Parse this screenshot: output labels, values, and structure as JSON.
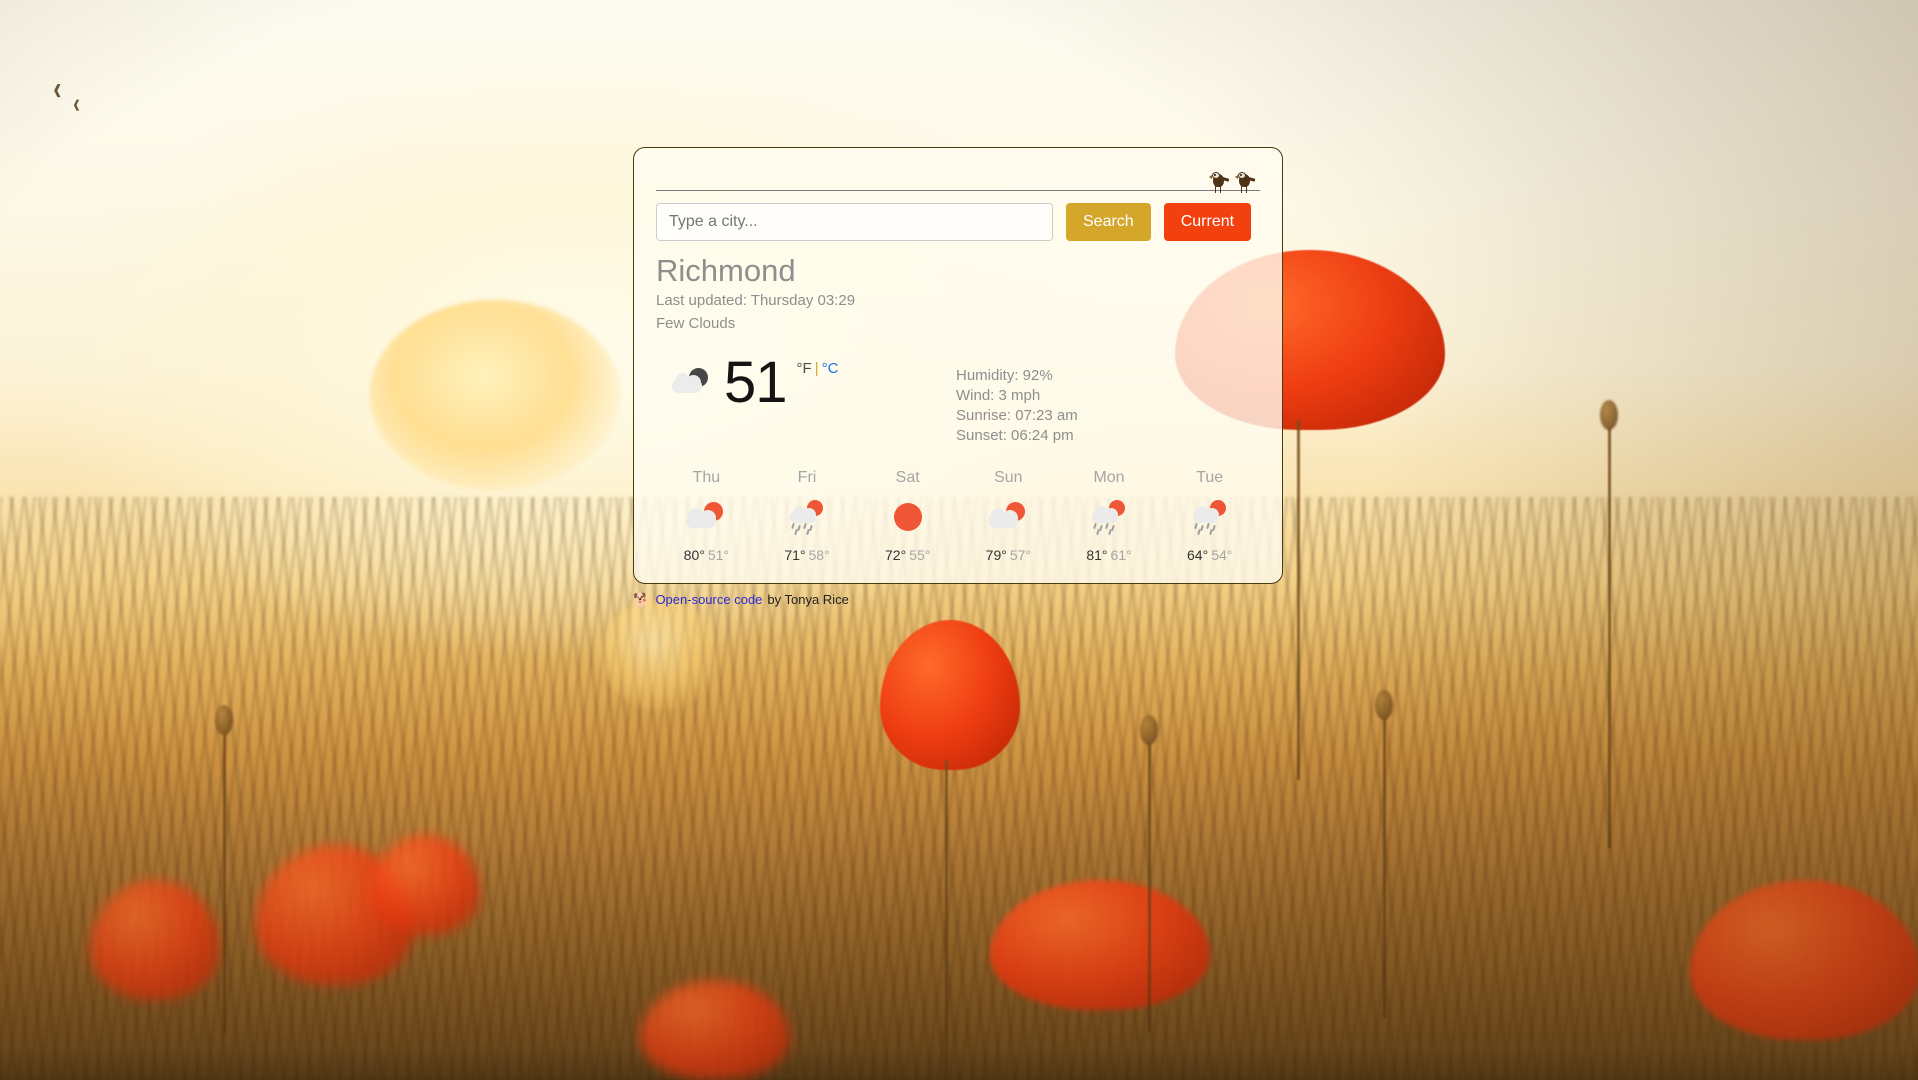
{
  "card": {
    "search": {
      "input_placeholder": "Type a city...",
      "input_value": "",
      "search_button": "Search",
      "current_button": "Current"
    },
    "location": {
      "city": "Richmond",
      "last_updated": "Last updated: Thursday 03:29",
      "condition": "Few Clouds"
    },
    "current": {
      "icon": "cloud-moon-icon",
      "temperature": "51",
      "unit_f": "°F",
      "unit_separator": "|",
      "unit_c": "°C",
      "details": [
        "Humidity: 92%",
        "Wind: 3 mph",
        "Sunrise: 07:23 am",
        "Sunset: 06:24 pm"
      ]
    },
    "forecast": [
      {
        "day": "Thu",
        "icon": "sun-cloud-icon",
        "high": "80°",
        "low": "51°"
      },
      {
        "day": "Fri",
        "icon": "sun-cloud-rain-icon",
        "high": "71°",
        "low": "58°"
      },
      {
        "day": "Sat",
        "icon": "sun-icon",
        "high": "72°",
        "low": "55°"
      },
      {
        "day": "Sun",
        "icon": "sun-cloud-icon",
        "high": "79°",
        "low": "57°"
      },
      {
        "day": "Mon",
        "icon": "sun-cloud-rain-icon",
        "high": "81°",
        "low": "61°"
      },
      {
        "day": "Tue",
        "icon": "sun-cloud-rain-icon",
        "high": "64°",
        "low": "54°"
      }
    ],
    "birds_icon": "two-birds-on-wire-icon"
  },
  "footer": {
    "emoji": "🐕",
    "emoji_name": "dog-emoji",
    "link_text": "Open-source code",
    "byline": "by Tonya Rice"
  },
  "colors": {
    "search_button": "#d4a62a",
    "current_button": "#f2400f",
    "link": "#2b2bd6",
    "unit_c_link": "#1a73e8",
    "sun": "#ef5635",
    "cloud": "#ebebeb",
    "moon": "#474747",
    "card_border": "#4a3a12"
  }
}
